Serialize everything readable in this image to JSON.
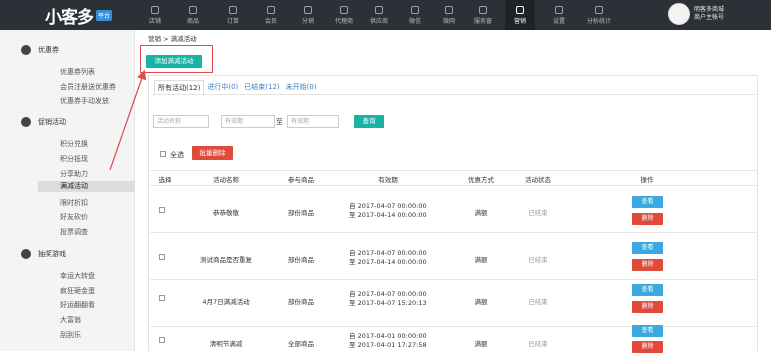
{
  "app": {
    "logo": "小客多",
    "logo_badge": "平台"
  },
  "topnav": [
    {
      "label": "店铺",
      "icon": "store-icon"
    },
    {
      "label": "商品",
      "icon": "goods-icon"
    },
    {
      "label": "订单",
      "icon": "order-icon"
    },
    {
      "label": "会员",
      "icon": "member-icon"
    },
    {
      "label": "分销",
      "icon": "distribution-icon"
    },
    {
      "label": "代理商",
      "icon": "agent-icon"
    },
    {
      "label": "供应商",
      "icon": "supplier-icon"
    },
    {
      "label": "微信",
      "icon": "wechat-icon"
    },
    {
      "label": "微网",
      "icon": "microsite-icon"
    },
    {
      "label": "服务窗",
      "icon": "service-window-icon"
    },
    {
      "label": "营销",
      "icon": "marketing-icon"
    },
    {
      "label": "设置",
      "icon": "settings-icon"
    },
    {
      "label": "分析统计",
      "icon": "analytics-icon"
    }
  ],
  "user": {
    "line1": "明客多商城",
    "line2": "商户主帐号"
  },
  "sidebar": {
    "groups": [
      {
        "title": "优惠券",
        "icon": "coupon-icon",
        "items": [
          "优惠券列表",
          "会员注册送优惠券",
          "优惠券手动发放"
        ]
      },
      {
        "title": "促销活动",
        "icon": "promotion-icon",
        "items": [
          "积分兑换",
          "积分抵现",
          "分享助力",
          "满减活动",
          "限时折扣",
          "好友砍价",
          "投票调查"
        ]
      },
      {
        "title": "抽奖游戏",
        "icon": "lottery-icon",
        "items": [
          "幸运大转盘",
          "疯狂砸金蛋",
          "好运翻翻看",
          "大富翁",
          "刮刮乐"
        ]
      }
    ]
  },
  "breadcrumb": "营销 > 满减活动",
  "add_button": "添加满减活动",
  "tabs": [
    "所有活动(12)",
    "进行中(0)",
    "已结束(12)",
    "未开始(0)"
  ],
  "filters": {
    "name_placeholder": "活动名称",
    "from_placeholder": "有效期",
    "to_label": "至",
    "to_placeholder": "有效期",
    "search_button": "查询"
  },
  "select_all": "全选",
  "bulk_delete": "批量删除",
  "table": {
    "headers": [
      "选择",
      "活动名称",
      "参与商品",
      "有效期",
      "优惠方式",
      "活动状态",
      "操作"
    ],
    "rows": [
      {
        "name": "恭恭敬敬",
        "goods": "部份商品",
        "from": "自 2017-04-07 00:00:00",
        "to": "至 2017-04-14 00:00:00",
        "type": "满额",
        "status": "已结束"
      },
      {
        "name": "测试商品是否重复",
        "goods": "部份商品",
        "from": "自 2017-04-07 00:00:00",
        "to": "至 2017-04-14 00:00:00",
        "type": "满额",
        "status": "已结束"
      },
      {
        "name": "4月7日满减活动",
        "goods": "部份商品",
        "from": "自 2017-04-07 00:00:00",
        "to": "至 2017-04-07 15:20:13",
        "type": "满额",
        "status": "已结束"
      },
      {
        "name": "清明节满减",
        "goods": "全部商品",
        "from": "自 2017-04-01 00:00:00",
        "to": "至 2017-04-01 17:27:58",
        "type": "满额",
        "status": "已结束"
      }
    ],
    "view_label": "查看",
    "delete_label": "删除"
  }
}
